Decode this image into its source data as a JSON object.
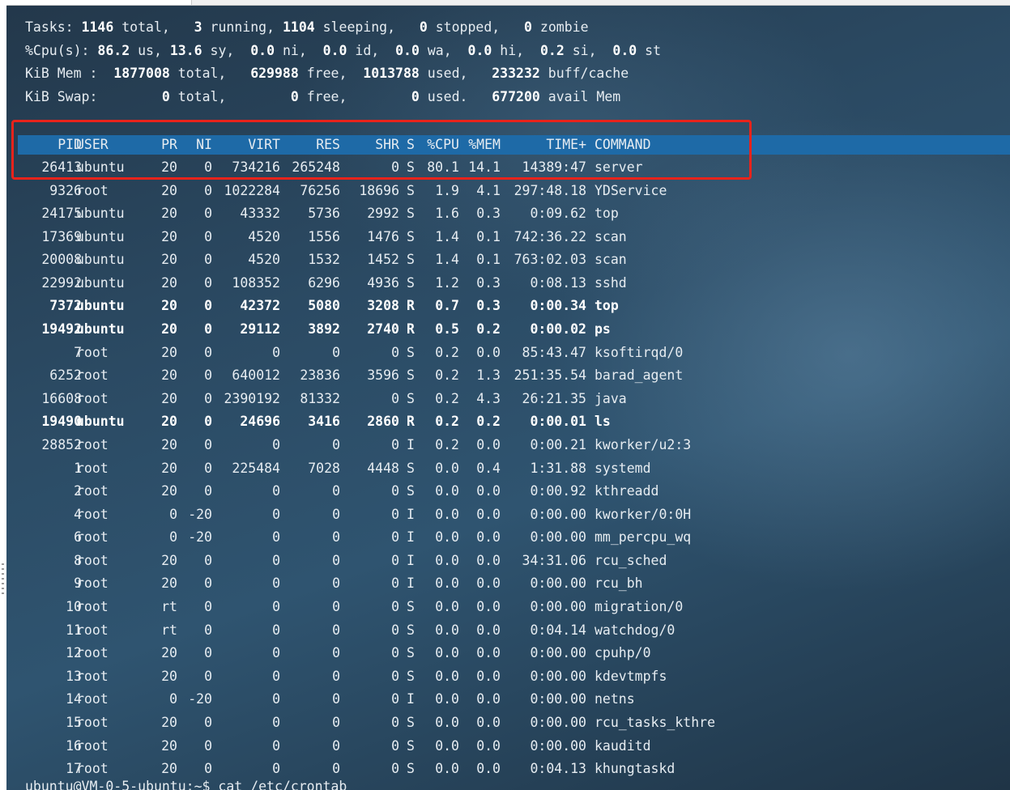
{
  "summary": {
    "tasks": {
      "label": "Tasks:",
      "total": "1146",
      "total_label": "total,",
      "running": "3",
      "running_label": "running,",
      "sleeping": "1104",
      "sleeping_label": "sleeping,",
      "stopped": "0",
      "stopped_label": "stopped,",
      "zombie": "0",
      "zombie_label": "zombie"
    },
    "cpu": {
      "label": "%Cpu(s):",
      "us": "86.2",
      "us_label": "us,",
      "sy": "13.6",
      "sy_label": "sy,",
      "ni": "0.0",
      "ni_label": "ni,",
      "id": "0.0",
      "id_label": "id,",
      "wa": "0.0",
      "wa_label": "wa,",
      "hi": "0.0",
      "hi_label": "hi,",
      "si": "0.2",
      "si_label": "si,",
      "st": "0.0",
      "st_label": "st"
    },
    "mem": {
      "label": "KiB Mem :",
      "total": "1877008",
      "total_label": "total,",
      "free": "629988",
      "free_label": "free,",
      "used": "1013788",
      "used_label": "used,",
      "buff": "233232",
      "buff_label": "buff/cache"
    },
    "swap": {
      "label": "KiB Swap:",
      "total": "0",
      "total_label": "total,",
      "free": "0",
      "free_label": "free,",
      "used": "0",
      "used_label": "used.",
      "avail": "677200",
      "avail_label": "avail Mem"
    }
  },
  "columns": {
    "pid": "PID",
    "user": "USER",
    "pr": "PR",
    "ni": "NI",
    "virt": "VIRT",
    "res": "RES",
    "shr": "SHR",
    "s": "S",
    "cpu": "%CPU",
    "mem": "%MEM",
    "time": "TIME+",
    "command": "COMMAND"
  },
  "processes": [
    {
      "pid": "26413",
      "user": "ubuntu",
      "pr": "20",
      "ni": "0",
      "virt": "734216",
      "res": "265248",
      "shr": "0",
      "s": "S",
      "cpu": "80.1",
      "mem": "14.1",
      "time": "14389:47",
      "command": "server",
      "bold": false
    },
    {
      "pid": "9326",
      "user": "root",
      "pr": "20",
      "ni": "0",
      "virt": "1022284",
      "res": "76256",
      "shr": "18696",
      "s": "S",
      "cpu": "1.9",
      "mem": "4.1",
      "time": "297:48.18",
      "command": "YDService",
      "bold": false
    },
    {
      "pid": "24175",
      "user": "ubuntu",
      "pr": "20",
      "ni": "0",
      "virt": "43332",
      "res": "5736",
      "shr": "2992",
      "s": "S",
      "cpu": "1.6",
      "mem": "0.3",
      "time": "0:09.62",
      "command": "top",
      "bold": false
    },
    {
      "pid": "17369",
      "user": "ubuntu",
      "pr": "20",
      "ni": "0",
      "virt": "4520",
      "res": "1556",
      "shr": "1476",
      "s": "S",
      "cpu": "1.4",
      "mem": "0.1",
      "time": "742:36.22",
      "command": "scan",
      "bold": false
    },
    {
      "pid": "20008",
      "user": "ubuntu",
      "pr": "20",
      "ni": "0",
      "virt": "4520",
      "res": "1532",
      "shr": "1452",
      "s": "S",
      "cpu": "1.4",
      "mem": "0.1",
      "time": "763:02.03",
      "command": "scan",
      "bold": false
    },
    {
      "pid": "22992",
      "user": "ubuntu",
      "pr": "20",
      "ni": "0",
      "virt": "108352",
      "res": "6296",
      "shr": "4936",
      "s": "S",
      "cpu": "1.2",
      "mem": "0.3",
      "time": "0:08.13",
      "command": "sshd",
      "bold": false
    },
    {
      "pid": "7372",
      "user": "ubuntu",
      "pr": "20",
      "ni": "0",
      "virt": "42372",
      "res": "5080",
      "shr": "3208",
      "s": "R",
      "cpu": "0.7",
      "mem": "0.3",
      "time": "0:00.34",
      "command": "top",
      "bold": true
    },
    {
      "pid": "19492",
      "user": "ubuntu",
      "pr": "20",
      "ni": "0",
      "virt": "29112",
      "res": "3892",
      "shr": "2740",
      "s": "R",
      "cpu": "0.5",
      "mem": "0.2",
      "time": "0:00.02",
      "command": "ps",
      "bold": true
    },
    {
      "pid": "7",
      "user": "root",
      "pr": "20",
      "ni": "0",
      "virt": "0",
      "res": "0",
      "shr": "0",
      "s": "S",
      "cpu": "0.2",
      "mem": "0.0",
      "time": "85:43.47",
      "command": "ksoftirqd/0",
      "bold": false
    },
    {
      "pid": "6252",
      "user": "root",
      "pr": "20",
      "ni": "0",
      "virt": "640012",
      "res": "23836",
      "shr": "3596",
      "s": "S",
      "cpu": "0.2",
      "mem": "1.3",
      "time": "251:35.54",
      "command": "barad_agent",
      "bold": false
    },
    {
      "pid": "16608",
      "user": "root",
      "pr": "20",
      "ni": "0",
      "virt": "2390192",
      "res": "81332",
      "shr": "0",
      "s": "S",
      "cpu": "0.2",
      "mem": "4.3",
      "time": "26:21.35",
      "command": "java",
      "bold": false
    },
    {
      "pid": "19490",
      "user": "ubuntu",
      "pr": "20",
      "ni": "0",
      "virt": "24696",
      "res": "3416",
      "shr": "2860",
      "s": "R",
      "cpu": "0.2",
      "mem": "0.2",
      "time": "0:00.01",
      "command": "ls",
      "bold": true
    },
    {
      "pid": "28852",
      "user": "root",
      "pr": "20",
      "ni": "0",
      "virt": "0",
      "res": "0",
      "shr": "0",
      "s": "I",
      "cpu": "0.2",
      "mem": "0.0",
      "time": "0:00.21",
      "command": "kworker/u2:3",
      "bold": false
    },
    {
      "pid": "1",
      "user": "root",
      "pr": "20",
      "ni": "0",
      "virt": "225484",
      "res": "7028",
      "shr": "4448",
      "s": "S",
      "cpu": "0.0",
      "mem": "0.4",
      "time": "1:31.88",
      "command": "systemd",
      "bold": false
    },
    {
      "pid": "2",
      "user": "root",
      "pr": "20",
      "ni": "0",
      "virt": "0",
      "res": "0",
      "shr": "0",
      "s": "S",
      "cpu": "0.0",
      "mem": "0.0",
      "time": "0:00.92",
      "command": "kthreadd",
      "bold": false
    },
    {
      "pid": "4",
      "user": "root",
      "pr": "0",
      "ni": "-20",
      "virt": "0",
      "res": "0",
      "shr": "0",
      "s": "I",
      "cpu": "0.0",
      "mem": "0.0",
      "time": "0:00.00",
      "command": "kworker/0:0H",
      "bold": false
    },
    {
      "pid": "6",
      "user": "root",
      "pr": "0",
      "ni": "-20",
      "virt": "0",
      "res": "0",
      "shr": "0",
      "s": "I",
      "cpu": "0.0",
      "mem": "0.0",
      "time": "0:00.00",
      "command": "mm_percpu_wq",
      "bold": false
    },
    {
      "pid": "8",
      "user": "root",
      "pr": "20",
      "ni": "0",
      "virt": "0",
      "res": "0",
      "shr": "0",
      "s": "I",
      "cpu": "0.0",
      "mem": "0.0",
      "time": "34:31.06",
      "command": "rcu_sched",
      "bold": false
    },
    {
      "pid": "9",
      "user": "root",
      "pr": "20",
      "ni": "0",
      "virt": "0",
      "res": "0",
      "shr": "0",
      "s": "I",
      "cpu": "0.0",
      "mem": "0.0",
      "time": "0:00.00",
      "command": "rcu_bh",
      "bold": false
    },
    {
      "pid": "10",
      "user": "root",
      "pr": "rt",
      "ni": "0",
      "virt": "0",
      "res": "0",
      "shr": "0",
      "s": "S",
      "cpu": "0.0",
      "mem": "0.0",
      "time": "0:00.00",
      "command": "migration/0",
      "bold": false
    },
    {
      "pid": "11",
      "user": "root",
      "pr": "rt",
      "ni": "0",
      "virt": "0",
      "res": "0",
      "shr": "0",
      "s": "S",
      "cpu": "0.0",
      "mem": "0.0",
      "time": "0:04.14",
      "command": "watchdog/0",
      "bold": false
    },
    {
      "pid": "12",
      "user": "root",
      "pr": "20",
      "ni": "0",
      "virt": "0",
      "res": "0",
      "shr": "0",
      "s": "S",
      "cpu": "0.0",
      "mem": "0.0",
      "time": "0:00.00",
      "command": "cpuhp/0",
      "bold": false
    },
    {
      "pid": "13",
      "user": "root",
      "pr": "20",
      "ni": "0",
      "virt": "0",
      "res": "0",
      "shr": "0",
      "s": "S",
      "cpu": "0.0",
      "mem": "0.0",
      "time": "0:00.00",
      "command": "kdevtmpfs",
      "bold": false
    },
    {
      "pid": "14",
      "user": "root",
      "pr": "0",
      "ni": "-20",
      "virt": "0",
      "res": "0",
      "shr": "0",
      "s": "I",
      "cpu": "0.0",
      "mem": "0.0",
      "time": "0:00.00",
      "command": "netns",
      "bold": false
    },
    {
      "pid": "15",
      "user": "root",
      "pr": "20",
      "ni": "0",
      "virt": "0",
      "res": "0",
      "shr": "0",
      "s": "S",
      "cpu": "0.0",
      "mem": "0.0",
      "time": "0:00.00",
      "command": "rcu_tasks_kthre",
      "bold": false
    },
    {
      "pid": "16",
      "user": "root",
      "pr": "20",
      "ni": "0",
      "virt": "0",
      "res": "0",
      "shr": "0",
      "s": "S",
      "cpu": "0.0",
      "mem": "0.0",
      "time": "0:00.00",
      "command": "kauditd",
      "bold": false
    },
    {
      "pid": "17",
      "user": "root",
      "pr": "20",
      "ni": "0",
      "virt": "0",
      "res": "0",
      "shr": "0",
      "s": "S",
      "cpu": "0.0",
      "mem": "0.0",
      "time": "0:04.13",
      "command": "khungtaskd",
      "bold": false
    }
  ],
  "prompt": "ubuntu@VM-0-5-ubuntu:~$ cat /etc/crontab",
  "colors": {
    "header_bar": "#1e6aa7",
    "highlight_border": "#e8231b",
    "text": "#e6ecf1"
  }
}
